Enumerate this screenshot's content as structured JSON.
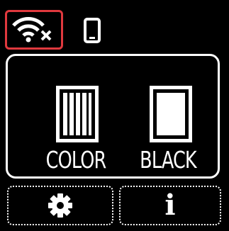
{
  "status_bar": {
    "wireless": {
      "icon": "wifi-disconnected-icon",
      "highlight_color": "#e0393e"
    },
    "direct_connection": {
      "icon": "smartphone-icon"
    }
  },
  "copy": {
    "color_label": "COLOR",
    "black_label": "BLACK"
  },
  "bottom_bar": {
    "settings": {
      "icon": "gear-icon"
    },
    "info": {
      "icon": "info-icon",
      "glyph": "i"
    }
  }
}
